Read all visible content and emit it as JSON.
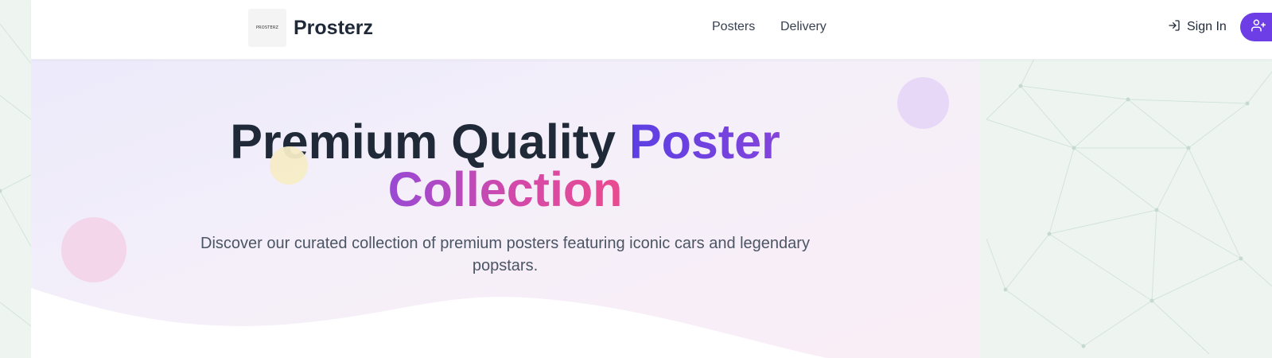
{
  "brand": {
    "name": "Prosterz",
    "logo_text": "PROSTERZ"
  },
  "nav": {
    "items": [
      {
        "label": "Posters"
      },
      {
        "label": "Delivery"
      }
    ]
  },
  "auth": {
    "sign_in_label": "Sign In"
  },
  "hero": {
    "title_part1": "Premium Quality ",
    "title_part2": "Poster",
    "title_part3": "Collection",
    "subtitle": "Discover our curated collection of premium posters featuring iconic cars and legendary popstars."
  },
  "colors": {
    "accent_purple": "#6d3ee6",
    "accent_pink": "#ea4b8f",
    "text_dark": "#1f2937",
    "text_muted": "#4b5563"
  }
}
